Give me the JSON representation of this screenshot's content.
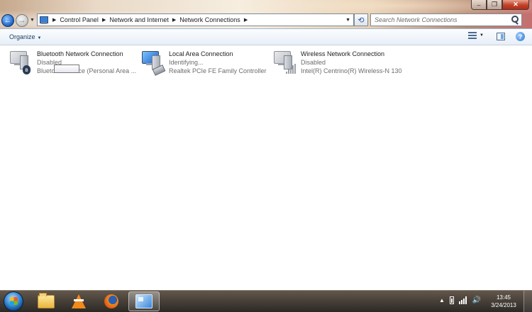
{
  "address_bar": {
    "breadcrumbs": [
      "Control Panel",
      "Network and Internet",
      "Network Connections"
    ]
  },
  "search": {
    "placeholder": "Search Network Connections"
  },
  "command_bar": {
    "organize_label": "Organize"
  },
  "connections": [
    {
      "name": "Bluetooth Network Connection",
      "status": "Disabled",
      "device": "Bluetooth Device (Personal Area ...",
      "icon": "bluetooth-network-icon"
    },
    {
      "name": "Local Area Connection",
      "status": "Identifying...",
      "device": "Realtek PCIe FE Family Controller",
      "icon": "local-area-network-icon"
    },
    {
      "name": "Wireless Network Connection",
      "status": "Disabled",
      "device": "Intel(R) Centrino(R) Wireless-N 130",
      "icon": "wireless-network-icon"
    }
  ],
  "taskbar": {
    "items": [
      "windows-explorer-icon",
      "vlc-icon",
      "firefox-icon",
      "network-connections-icon"
    ],
    "clock_time": "13:45",
    "clock_date": "3/24/2013"
  },
  "colors": {
    "accent": "#2a6fd1",
    "content_bg": "#ffffff",
    "status_text": "#6d6d6d"
  }
}
